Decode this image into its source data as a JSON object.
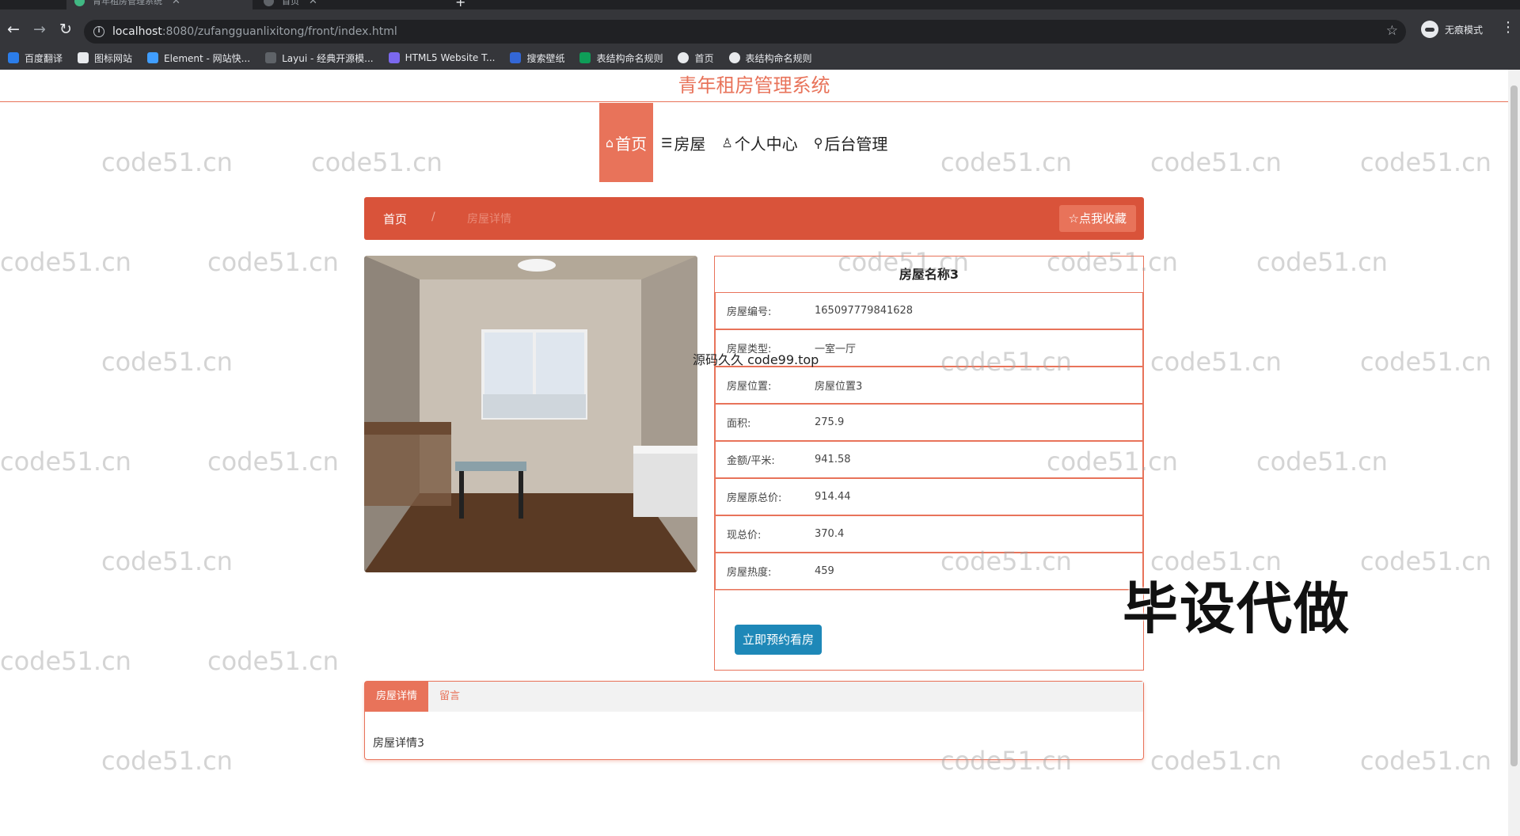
{
  "browser": {
    "tabs": [
      {
        "title": "青年租房管理系统",
        "active": true
      },
      {
        "title": "首页",
        "active": false
      }
    ],
    "url_host": "localhost",
    "url_rest": ":8080/zufangguanlixitong/front/index.html",
    "incognito_label": "无痕模式",
    "bookmarks": [
      "百度翻译",
      "图标网站",
      "Element - 网站快...",
      "Layui - 经典开源模...",
      "HTML5 Website T...",
      "搜索壁纸",
      "表结构命名规则",
      "首页",
      "表结构命名规则"
    ]
  },
  "site": {
    "title": "青年租房管理系统",
    "nav": [
      {
        "icon": "⌂",
        "label": "首页",
        "active": true
      },
      {
        "icon": "☰",
        "label": "房屋",
        "active": false
      },
      {
        "icon": "♙",
        "label": "个人中心",
        "active": false
      },
      {
        "icon": "⚲",
        "label": "后台管理",
        "active": false
      }
    ]
  },
  "breadcrumb": {
    "home": "首页",
    "separator": "/",
    "current": "房屋详情",
    "favorite_label": "☆点我收藏"
  },
  "house": {
    "name": "房屋名称3",
    "fields": [
      {
        "label": "房屋编号:",
        "value": "1650977798416​28"
      },
      {
        "label": "房屋类型:",
        "value": "一室一厅"
      },
      {
        "label": "房屋位置:",
        "value": "房屋位置3"
      },
      {
        "label": "面积:",
        "value": "275.9"
      },
      {
        "label": "金额/平米:",
        "value": "941.58"
      },
      {
        "label": "房屋原总价:",
        "value": "914.44"
      },
      {
        "label": "现总价:",
        "value": "370.4"
      },
      {
        "label": "房屋热度:",
        "value": "459"
      }
    ],
    "book_label": "立即预约看房"
  },
  "detail": {
    "tabs": [
      {
        "label": "房屋详情",
        "active": true
      },
      {
        "label": "留言",
        "active": false
      }
    ],
    "body": "房屋详情3"
  },
  "overlays": {
    "watermark": "code51.cn",
    "center_text": "源码久久 code99.top",
    "big_text": "毕设代做"
  },
  "colors": {
    "accent": "#e8735a",
    "breadcrumb_bg": "#d9533a",
    "book_button": "#1e88b8"
  }
}
